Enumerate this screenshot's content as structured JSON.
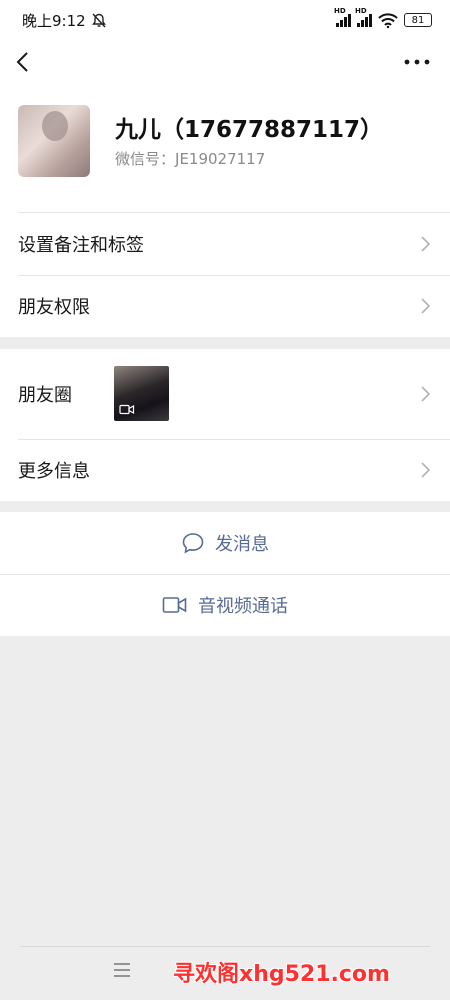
{
  "status_bar": {
    "time": "晚上9:12",
    "signal_badge_1": "HD",
    "signal_badge_2": "HD",
    "battery": "81"
  },
  "profile": {
    "name": "九儿（17677887117）",
    "wechat_id_label": "微信号：",
    "wechat_id": "JE19027117"
  },
  "settings": {
    "items": [
      {
        "label": "设置备注和标签"
      },
      {
        "label": "朋友权限"
      }
    ]
  },
  "info": {
    "moments_label": "朋友圈",
    "more_info_label": "更多信息"
  },
  "actions": {
    "message_label": "发消息",
    "video_call_label": "音视频通话"
  },
  "footer": {
    "watermark": "寻欢阁xhg521.com"
  },
  "colors": {
    "accent_link": "#576b95",
    "watermark": "#ff3030",
    "background": "#ededed"
  }
}
